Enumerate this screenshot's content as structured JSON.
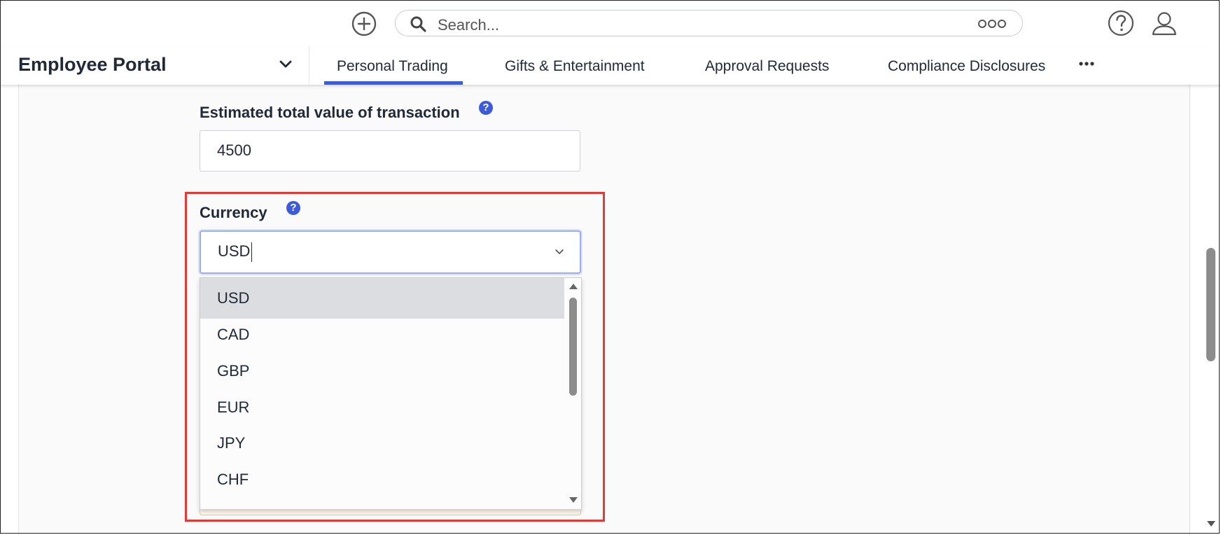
{
  "topbar": {
    "search_placeholder": "Search...",
    "icons": [
      "plus-circle-icon",
      "search-icon",
      "more-options-icon",
      "help-icon",
      "user-icon"
    ]
  },
  "navbar": {
    "portal_title": "Employee Portal",
    "tabs": [
      {
        "label": "Personal Trading",
        "active": true
      },
      {
        "label": "Gifts & Entertainment",
        "active": false
      },
      {
        "label": "Approval Requests",
        "active": false
      },
      {
        "label": "Compliance Disclosures",
        "active": false
      }
    ]
  },
  "form": {
    "transaction_label": "Estimated total value of transaction",
    "transaction_value": "4500",
    "help_glyph": "?",
    "currency_label": "Currency",
    "currency_value": "USD",
    "currency_options": [
      "USD",
      "CAD",
      "GBP",
      "EUR",
      "JPY",
      "CHF"
    ],
    "selected_option": "USD"
  },
  "colors": {
    "accent": "#3d5bd9",
    "highlight_border": "#e53935",
    "selected_option_bg": "#dcdde0"
  }
}
